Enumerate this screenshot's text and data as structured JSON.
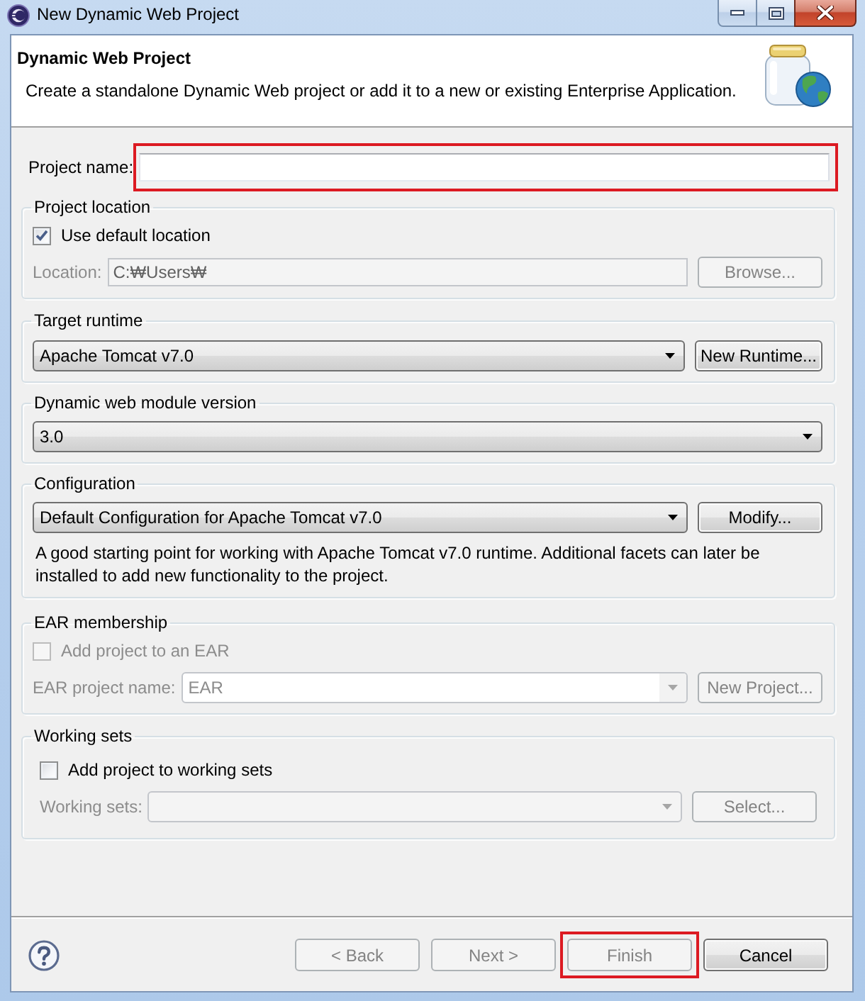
{
  "window": {
    "title": "New Dynamic Web Project"
  },
  "header": {
    "title": "Dynamic Web Project",
    "description": "Create a standalone Dynamic Web project or add it to a new or existing Enterprise Application."
  },
  "project_name": {
    "label": "Project name:",
    "highlighted": true
  },
  "project_location": {
    "title": "Project location",
    "use_default": {
      "label": "Use default location",
      "checked": true,
      "disabled": false
    },
    "location": {
      "label": "Location:",
      "value": "C:₩Users₩",
      "disabled": true
    },
    "browse_button": {
      "label": "Browse...",
      "disabled": true
    }
  },
  "target_runtime": {
    "title": "Target runtime",
    "value": "Apache Tomcat v7.0",
    "button": {
      "label": "New Runtime...",
      "disabled": false
    }
  },
  "module_version": {
    "title": "Dynamic web module version",
    "value": "3.0"
  },
  "configuration": {
    "title": "Configuration",
    "value": "Default Configuration for Apache Tomcat v7.0",
    "button": {
      "label": "Modify...",
      "disabled": false
    },
    "description": "A good starting point for working with Apache Tomcat v7.0 runtime. Additional facets can later be installed to add new functionality to the project."
  },
  "ear_membership": {
    "title": "EAR membership",
    "add_to_ear": {
      "label": "Add project to an EAR",
      "checked": false,
      "disabled": true
    },
    "ear_project": {
      "label": "EAR project name:",
      "value": "EAR",
      "disabled": true
    },
    "button": {
      "label": "New Project...",
      "disabled": true
    }
  },
  "working_sets": {
    "title": "Working sets",
    "add_to_sets": {
      "label": "Add project to working sets",
      "checked": false,
      "disabled": false
    },
    "sets": {
      "label": "Working sets:",
      "disabled": true
    },
    "button": {
      "label": "Select...",
      "disabled": true
    }
  },
  "buttons": [
    {
      "label": "< Back",
      "disabled": true,
      "highlighted": false
    },
    {
      "label": "Next >",
      "disabled": true,
      "highlighted": false
    },
    {
      "label": "Finish",
      "disabled": true,
      "highlighted": true
    },
    {
      "label": "Cancel",
      "disabled": false,
      "highlighted": false
    }
  ]
}
